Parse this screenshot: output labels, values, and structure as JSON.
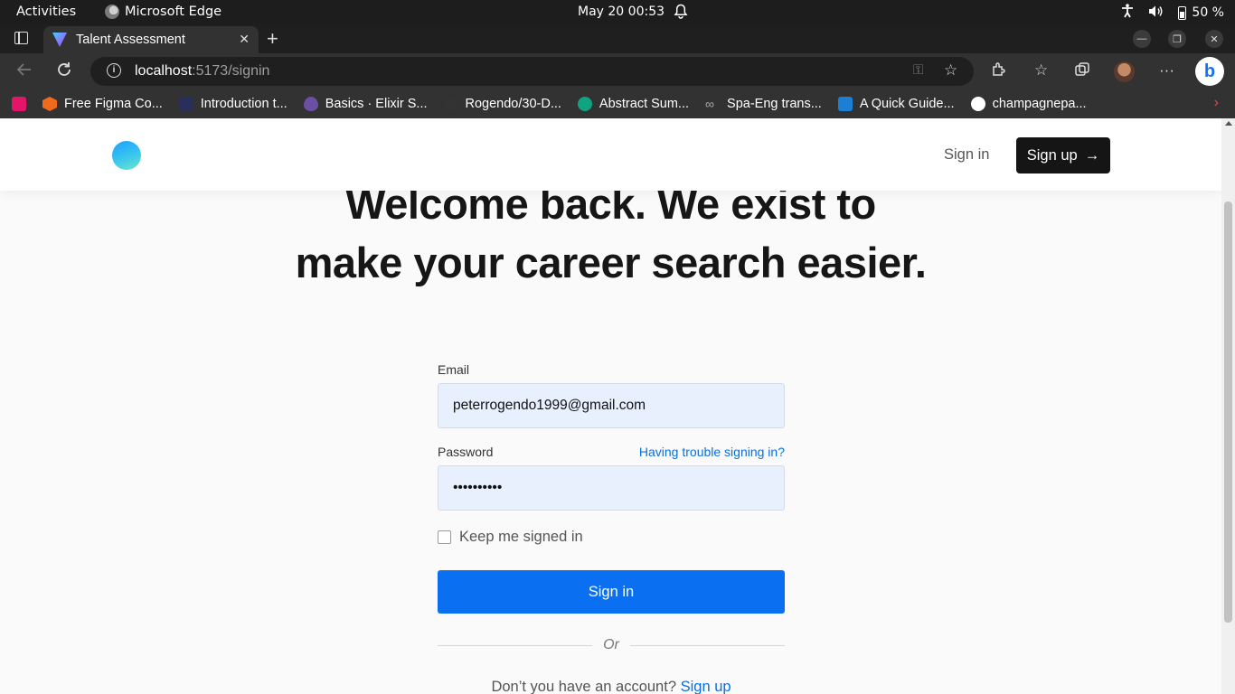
{
  "system": {
    "activities": "Activities",
    "app_name": "Microsoft Edge",
    "clock": "May 20  00:53",
    "battery": "50 %"
  },
  "browser": {
    "tab_title": "Talent Assessment",
    "url_host": "localhost",
    "url_rest": ":5173/signin",
    "bookmarks": [
      {
        "label": "Free Figma Co...",
        "color": "#f06a1d"
      },
      {
        "label": "Introduction t...",
        "color": "#2a2f5a"
      },
      {
        "label": "Basics · Elixir S...",
        "color": "#6b4fa3"
      },
      {
        "label": "Rogendo/30-D...",
        "color": "#333333"
      },
      {
        "label": "Abstract Sum...",
        "color": "#10a37f"
      },
      {
        "label": "Spa-Eng trans...",
        "color": "#888888"
      },
      {
        "label": "A Quick Guide...",
        "color": "#1b7fd6"
      },
      {
        "label": "champagnepa...",
        "color": "#ffffff"
      }
    ]
  },
  "header": {
    "signin_label": "Sign in",
    "signup_label": "Sign up",
    "signup_arrow": "→"
  },
  "hero": {
    "line1": "Welcome back. We exist to",
    "line2": "make your career search easier."
  },
  "form": {
    "email_label": "Email",
    "email_value": "peterrogendo1999@gmail.com",
    "password_label": "Password",
    "password_value": "••••••••••",
    "trouble_link": "Having trouble signing in?",
    "keep_signed_in": "Keep me signed in",
    "submit_label": "Sign in",
    "or_text": "Or",
    "no_account_text": "Don’t you have an account?",
    "signup_link": "Sign up"
  }
}
